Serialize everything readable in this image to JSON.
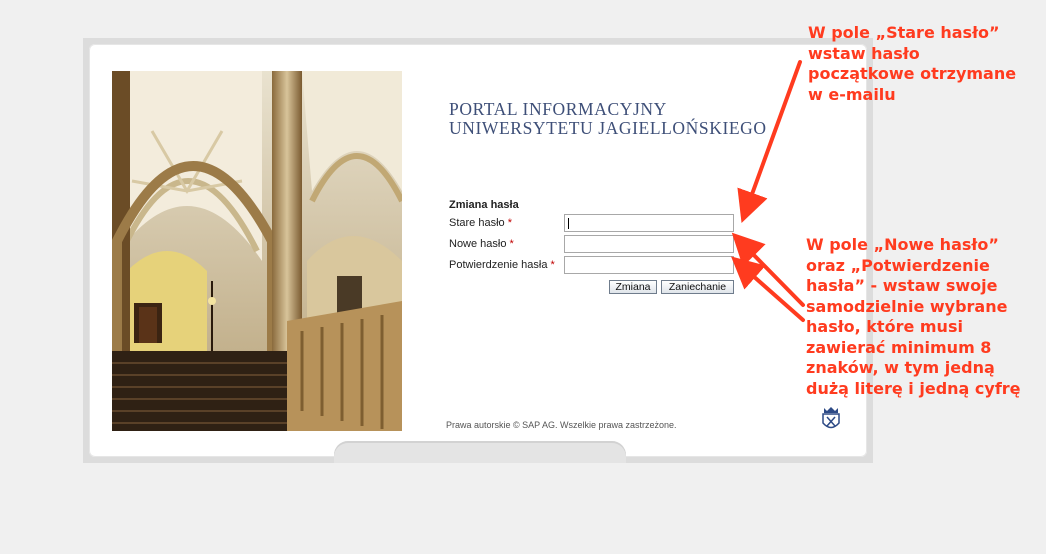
{
  "portal": {
    "title_line1": "PORTAL INFORMACYJNY",
    "title_line2": "UNIWERSYTETU JAGIELLOŃSKIEGO"
  },
  "form": {
    "heading": "Zmiana hasła",
    "fields": [
      {
        "label": "Stare hasło",
        "required_mark": "*",
        "value": ""
      },
      {
        "label": "Nowe hasło",
        "required_mark": "*",
        "value": ""
      },
      {
        "label": "Potwierdzenie hasła",
        "required_mark": "*",
        "value": ""
      }
    ],
    "submit_label": "Zmiana",
    "cancel_label": "Zaniechanie"
  },
  "footer": {
    "copyright": "Prawa autorskie © SAP AG. Wszelkie prawa zastrzeżone.",
    "emblem_icon": "university-crest-icon"
  },
  "annotations": {
    "color": "#ff3b1f",
    "note1_lines": [
      "W pole „Stare hasło”",
      "wstaw hasło",
      "początkowe otrzymane",
      "w e-mailu"
    ],
    "note2_lines": [
      "W pole „Nowe hasło”",
      "oraz „Potwierdzenie",
      "hasła” - wstaw swoje",
      "samodzielnie wybrane",
      "hasło, które musi",
      "zawierać minimum 8",
      "znaków, w tym jedną",
      "dużą literę i jedną cyfrę"
    ]
  }
}
